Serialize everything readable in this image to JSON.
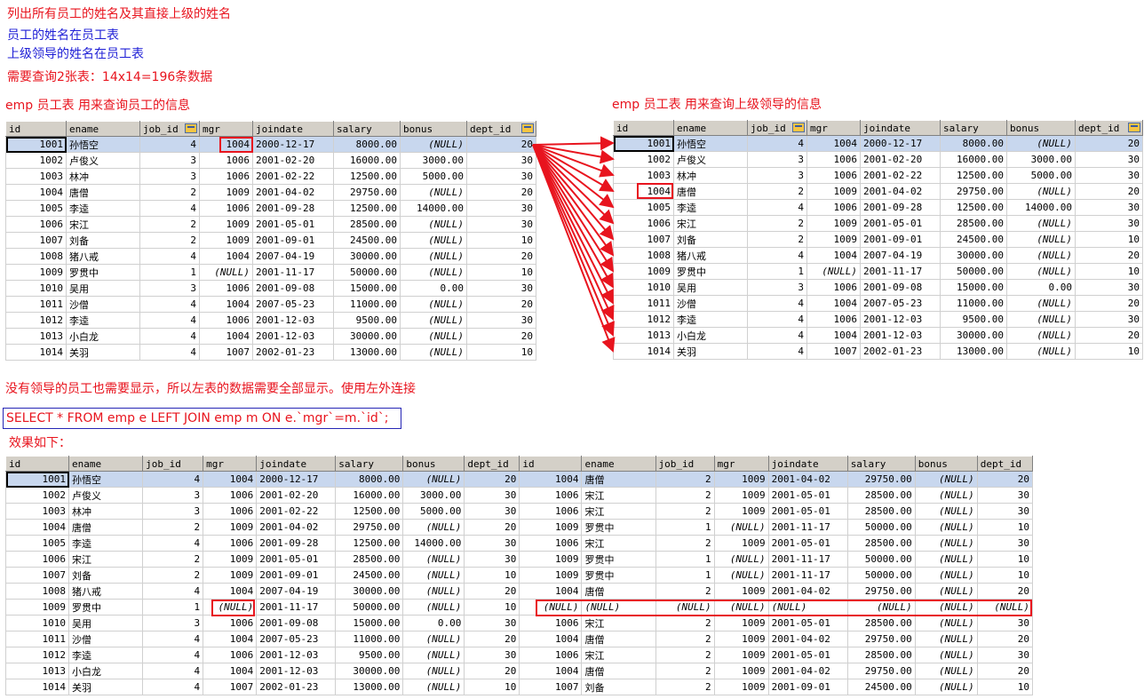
{
  "notes": {
    "title": "列出所有员工的姓名及其直接上级的姓名",
    "line1": "员工的姓名在员工表",
    "line2": "上级领导的姓名在员工表",
    "line3": "需要查询2张表：14x14=196条数据",
    "left_caption": "emp 员工表  用来查询员工的信息",
    "right_caption": "emp 员工表  用来查询上级领导的信息",
    "explanation": "没有领导的员工也需要显示，所以左表的数据需要全部显示。使用左外连接",
    "sql": "SELECT * FROM emp e LEFT JOIN emp m ON e.`mgr`=m.`id`;",
    "result_caption": "效果如下："
  },
  "colors": {
    "red": "#e8141e",
    "blue": "#1f1fd6",
    "header_bg": "#d4d0c8",
    "selected_row": "#c8d7ee"
  },
  "emp": {
    "columns": [
      "id",
      "ename",
      "job_id",
      "mgr",
      "joindate",
      "salary",
      "bonus",
      "dept_id"
    ],
    "rows": [
      [
        "1001",
        "孙悟空",
        "4",
        "1004",
        "2000-12-17",
        "8000.00",
        "(NULL)",
        "20"
      ],
      [
        "1002",
        "卢俊义",
        "3",
        "1006",
        "2001-02-20",
        "16000.00",
        "3000.00",
        "30"
      ],
      [
        "1003",
        "林冲",
        "3",
        "1006",
        "2001-02-22",
        "12500.00",
        "5000.00",
        "30"
      ],
      [
        "1004",
        "唐僧",
        "2",
        "1009",
        "2001-04-02",
        "29750.00",
        "(NULL)",
        "20"
      ],
      [
        "1005",
        "李逵",
        "4",
        "1006",
        "2001-09-28",
        "12500.00",
        "14000.00",
        "30"
      ],
      [
        "1006",
        "宋江",
        "2",
        "1009",
        "2001-05-01",
        "28500.00",
        "(NULL)",
        "30"
      ],
      [
        "1007",
        "刘备",
        "2",
        "1009",
        "2001-09-01",
        "24500.00",
        "(NULL)",
        "10"
      ],
      [
        "1008",
        "猪八戒",
        "4",
        "1004",
        "2007-04-19",
        "30000.00",
        "(NULL)",
        "20"
      ],
      [
        "1009",
        "罗贯中",
        "1",
        "(NULL)",
        "2001-11-17",
        "50000.00",
        "(NULL)",
        "10"
      ],
      [
        "1010",
        "吴用",
        "3",
        "1006",
        "2001-09-08",
        "15000.00",
        "0.00",
        "30"
      ],
      [
        "1011",
        "沙僧",
        "4",
        "1004",
        "2007-05-23",
        "11000.00",
        "(NULL)",
        "20"
      ],
      [
        "1012",
        "李逵",
        "4",
        "1006",
        "2001-12-03",
        "9500.00",
        "(NULL)",
        "30"
      ],
      [
        "1013",
        "小白龙",
        "4",
        "1004",
        "2001-12-03",
        "30000.00",
        "(NULL)",
        "20"
      ],
      [
        "1014",
        "关羽",
        "4",
        "1007",
        "2002-01-23",
        "13000.00",
        "(NULL)",
        "10"
      ]
    ]
  },
  "result": {
    "columns": [
      "id",
      "ename",
      "job_id",
      "mgr",
      "joindate",
      "salary",
      "bonus",
      "dept_id",
      "id",
      "ename",
      "job_id",
      "mgr",
      "joindate",
      "salary",
      "bonus",
      "dept_id"
    ],
    "rows": [
      [
        "1001",
        "孙悟空",
        "4",
        "1004",
        "2000-12-17",
        "8000.00",
        "(NULL)",
        "20",
        "1004",
        "唐僧",
        "2",
        "1009",
        "2001-04-02",
        "29750.00",
        "(NULL)",
        "20"
      ],
      [
        "1002",
        "卢俊义",
        "3",
        "1006",
        "2001-02-20",
        "16000.00",
        "3000.00",
        "30",
        "1006",
        "宋江",
        "2",
        "1009",
        "2001-05-01",
        "28500.00",
        "(NULL)",
        "30"
      ],
      [
        "1003",
        "林冲",
        "3",
        "1006",
        "2001-02-22",
        "12500.00",
        "5000.00",
        "30",
        "1006",
        "宋江",
        "2",
        "1009",
        "2001-05-01",
        "28500.00",
        "(NULL)",
        "30"
      ],
      [
        "1004",
        "唐僧",
        "2",
        "1009",
        "2001-04-02",
        "29750.00",
        "(NULL)",
        "20",
        "1009",
        "罗贯中",
        "1",
        "(NULL)",
        "2001-11-17",
        "50000.00",
        "(NULL)",
        "10"
      ],
      [
        "1005",
        "李逵",
        "4",
        "1006",
        "2001-09-28",
        "12500.00",
        "14000.00",
        "30",
        "1006",
        "宋江",
        "2",
        "1009",
        "2001-05-01",
        "28500.00",
        "(NULL)",
        "30"
      ],
      [
        "1006",
        "宋江",
        "2",
        "1009",
        "2001-05-01",
        "28500.00",
        "(NULL)",
        "30",
        "1009",
        "罗贯中",
        "1",
        "(NULL)",
        "2001-11-17",
        "50000.00",
        "(NULL)",
        "10"
      ],
      [
        "1007",
        "刘备",
        "2",
        "1009",
        "2001-09-01",
        "24500.00",
        "(NULL)",
        "10",
        "1009",
        "罗贯中",
        "1",
        "(NULL)",
        "2001-11-17",
        "50000.00",
        "(NULL)",
        "10"
      ],
      [
        "1008",
        "猪八戒",
        "4",
        "1004",
        "2007-04-19",
        "30000.00",
        "(NULL)",
        "20",
        "1004",
        "唐僧",
        "2",
        "1009",
        "2001-04-02",
        "29750.00",
        "(NULL)",
        "20"
      ],
      [
        "1009",
        "罗贯中",
        "1",
        "(NULL)",
        "2001-11-17",
        "50000.00",
        "(NULL)",
        "10",
        "(NULL)",
        "(NULL)",
        "(NULL)",
        "(NULL)",
        "(NULL)",
        "(NULL)",
        "(NULL)",
        "(NULL)"
      ],
      [
        "1010",
        "吴用",
        "3",
        "1006",
        "2001-09-08",
        "15000.00",
        "0.00",
        "30",
        "1006",
        "宋江",
        "2",
        "1009",
        "2001-05-01",
        "28500.00",
        "(NULL)",
        "30"
      ],
      [
        "1011",
        "沙僧",
        "4",
        "1004",
        "2007-05-23",
        "11000.00",
        "(NULL)",
        "20",
        "1004",
        "唐僧",
        "2",
        "1009",
        "2001-04-02",
        "29750.00",
        "(NULL)",
        "20"
      ],
      [
        "1012",
        "李逵",
        "4",
        "1006",
        "2001-12-03",
        "9500.00",
        "(NULL)",
        "30",
        "1006",
        "宋江",
        "2",
        "1009",
        "2001-05-01",
        "28500.00",
        "(NULL)",
        "30"
      ],
      [
        "1013",
        "小白龙",
        "4",
        "1004",
        "2001-12-03",
        "30000.00",
        "(NULL)",
        "20",
        "1004",
        "唐僧",
        "2",
        "1009",
        "2001-04-02",
        "29750.00",
        "(NULL)",
        "20"
      ],
      [
        "1014",
        "关羽",
        "4",
        "1007",
        "2002-01-23",
        "13000.00",
        "(NULL)",
        "10",
        "1007",
        "刘备",
        "2",
        "1009",
        "2001-09-01",
        "24500.00",
        "(NULL)",
        "10"
      ]
    ]
  }
}
